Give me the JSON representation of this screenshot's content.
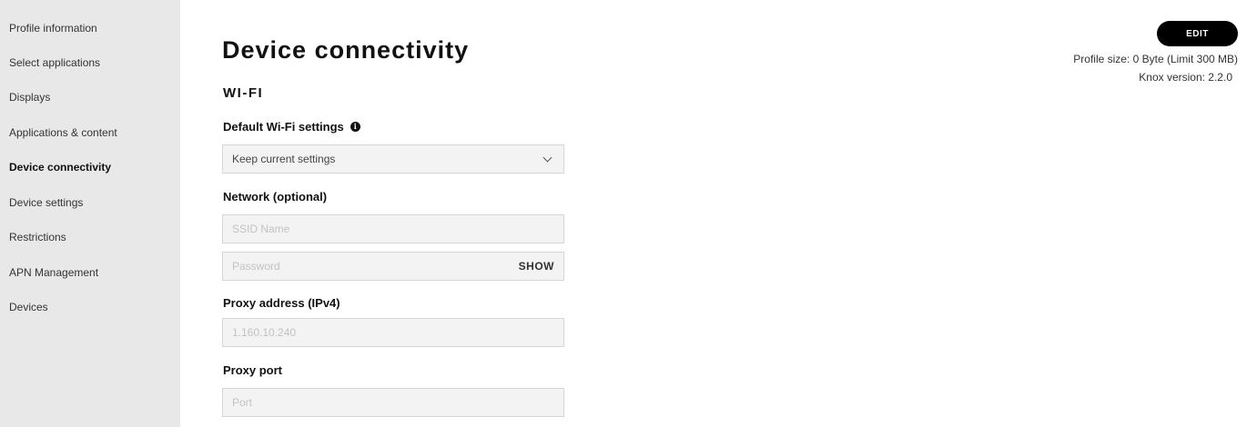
{
  "sidebar": {
    "items": [
      {
        "label": "Profile information"
      },
      {
        "label": "Select applications"
      },
      {
        "label": "Displays"
      },
      {
        "label": "Applications & content"
      },
      {
        "label": "Device connectivity"
      },
      {
        "label": "Device settings"
      },
      {
        "label": "Restrictions"
      },
      {
        "label": "APN Management"
      },
      {
        "label": "Devices"
      }
    ],
    "active_item": "Device connectivity"
  },
  "header": {
    "title": "Device connectivity",
    "edit_label": "EDIT",
    "profile_size": "Profile size: 0 Byte (Limit 300 MB)",
    "knox_version": "Knox version: 2.2.0"
  },
  "wifi": {
    "section_title": "WI-FI",
    "default_settings_label": "Default Wi-Fi settings",
    "default_settings_icon": "info-icon",
    "default_settings_value": "Keep current settings",
    "network_label": "Network (optional)",
    "ssid_placeholder": "SSID Name",
    "password_placeholder": "Password",
    "show_label": "SHOW",
    "proxy_address_label": "Proxy address (IPv4)",
    "proxy_address_placeholder": "1.160.10.240",
    "proxy_port_label": "Proxy port",
    "proxy_port_placeholder": "Port"
  }
}
